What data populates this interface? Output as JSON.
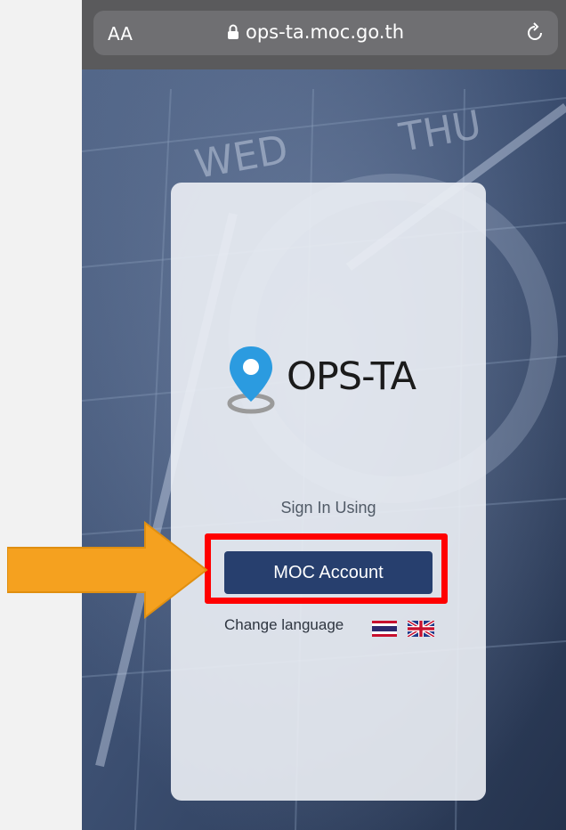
{
  "browser": {
    "text_size_label": "AA",
    "url": "ops-ta.moc.go.th"
  },
  "app": {
    "logo_text": "OPS-TA"
  },
  "login": {
    "sign_in_label": "Sign In Using",
    "moc_button_label": "MOC Account",
    "change_language_label": "Change language"
  },
  "colors": {
    "button": "#273f6e",
    "highlight": "#ff0000",
    "arrow": "#f5a11f",
    "pin": "#2b9be0"
  },
  "icons": [
    "lock-icon",
    "reload-icon",
    "map-pin-icon",
    "thai-flag-icon",
    "uk-flag-icon",
    "arrow-pointer"
  ]
}
